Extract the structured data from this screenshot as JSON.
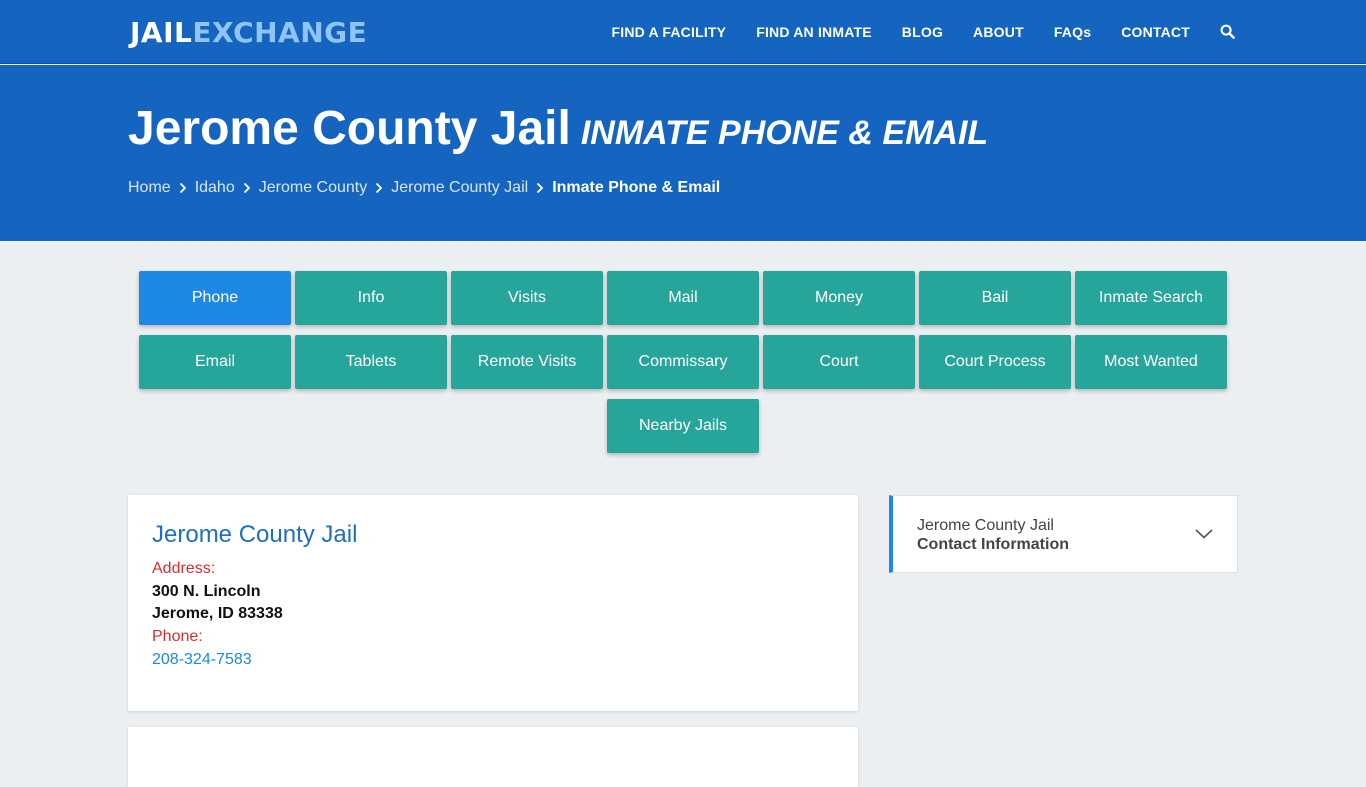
{
  "brand": {
    "logo_part1": "JAIL",
    "logo_part2": "EXCHANGE"
  },
  "nav": {
    "items": [
      "FIND A FACILITY",
      "FIND AN INMATE",
      "BLOG",
      "ABOUT",
      "FAQs",
      "CONTACT"
    ],
    "search_icon": "search-icon"
  },
  "hero": {
    "title": "Jerome County Jail",
    "subtitle": "INMATE PHONE & EMAIL",
    "breadcrumb": [
      "Home",
      "Idaho",
      "Jerome County",
      "Jerome County Jail",
      "Inmate Phone & Email"
    ]
  },
  "tabs": {
    "row1": [
      "Phone",
      "Info",
      "Visits",
      "Mail",
      "Money",
      "Bail",
      "Inmate Search"
    ],
    "row2": [
      "Email",
      "Tablets",
      "Remote Visits",
      "Commissary",
      "Court",
      "Court Process",
      "Most Wanted"
    ],
    "row3": [
      "Nearby Jails"
    ],
    "active": "Phone"
  },
  "facility_card": {
    "name": "Jerome County Jail",
    "address_label": "Address:",
    "address_line1": "300 N. Lincoln",
    "address_line2": "Jerome, ID 83338",
    "phone_label": "Phone:",
    "phone": "208-324-7583"
  },
  "sidebar": {
    "line1": "Jerome County Jail",
    "line2": "Contact Information"
  },
  "colors": {
    "header_blue": "#1565c0",
    "tab_teal": "#26a69a",
    "tab_active_blue": "#1e88e5",
    "label_red": "#d32f2f",
    "link_blue": "#1e88e5"
  }
}
